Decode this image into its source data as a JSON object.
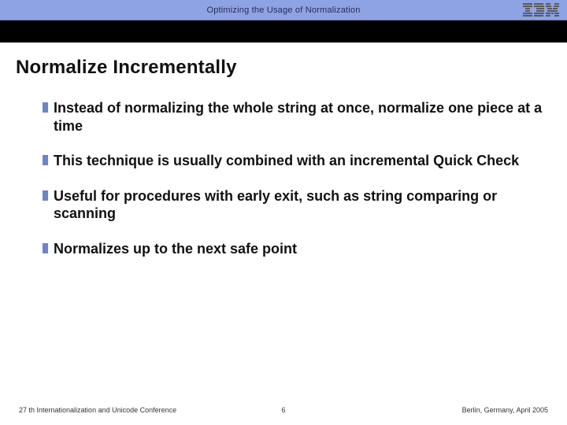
{
  "header": {
    "title": "Optimizing the Usage of Normalization",
    "logo_alt": "IBM"
  },
  "slide": {
    "title": "Normalize Incrementally",
    "bullets": [
      "Instead of normalizing the whole string at once, normalize one piece at a time",
      "This technique is usually combined with an incremental Quick Check",
      "Useful for procedures with early exit, such as string comparing or scanning",
      "Normalizes up to the next safe point"
    ]
  },
  "footer": {
    "left": "27 th Internationalization and Unicode Conference",
    "page": "6",
    "right": "Berlin, Germany, April 2005"
  }
}
